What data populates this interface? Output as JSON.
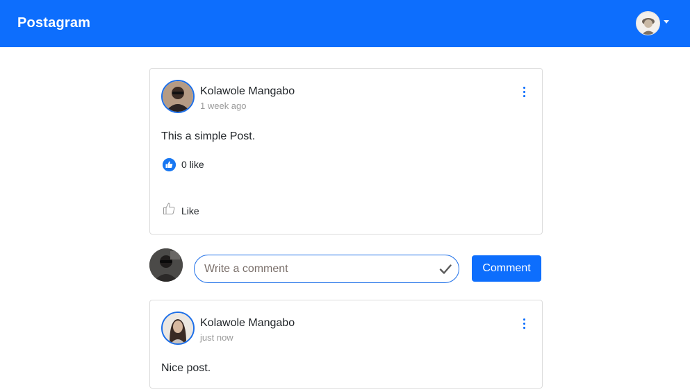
{
  "navbar": {
    "brand": "Postagram",
    "avatar_icon": "user-avatar-icon",
    "dropdown_icon": "caret-down-icon",
    "background": "#0d6efd"
  },
  "post": {
    "author": "Kolawole Mangabo",
    "time": "1 week ago",
    "text": "This a simple Post.",
    "like_count_label": "0 like",
    "like_action_label": "Like",
    "menu_icon": "kebab-menu-icon"
  },
  "comment_form": {
    "placeholder": "Write a comment",
    "value": "",
    "submit_label": "Comment",
    "check_icon": "check-icon"
  },
  "comments": [
    {
      "author": "Kolawole Mangabo",
      "time": "just now",
      "text": "Nice post."
    }
  ],
  "colors": {
    "accent": "#0d6efd",
    "like_badge": "#1877f2",
    "border": "#dcdcdc",
    "muted_text": "#9a9a9a"
  }
}
